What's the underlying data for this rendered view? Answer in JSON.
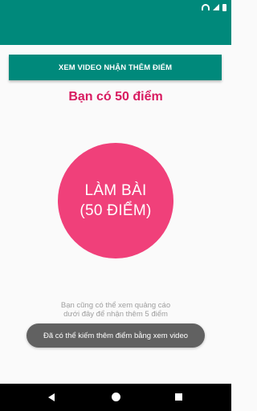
{
  "colors": {
    "primary": "#00897b",
    "accent_text": "#d81b60",
    "quiz_button": "#f0407a",
    "toast_bg": "#616161"
  },
  "status_bar": {
    "icons": [
      "wifi-icon",
      "signal-icon",
      "battery-icon"
    ]
  },
  "main": {
    "video_button_label": "XEM VIDEO NHẬN THÊM ĐIỂM",
    "points_text": "Bạn có 50 điểm",
    "quiz_button": {
      "line1": "LÀM BÀI",
      "line2": "(50 ĐIỂM)"
    },
    "hint_line1": "Bạn cũng có thể xem quảng cáo",
    "hint_line2": "dưới đây để nhận thêm 5 điểm"
  },
  "toast": {
    "message": "Đã có thể kiếm thêm điểm bằng xem video"
  },
  "nav_bar": {
    "icons": [
      "back-icon",
      "home-icon",
      "recents-icon"
    ]
  }
}
